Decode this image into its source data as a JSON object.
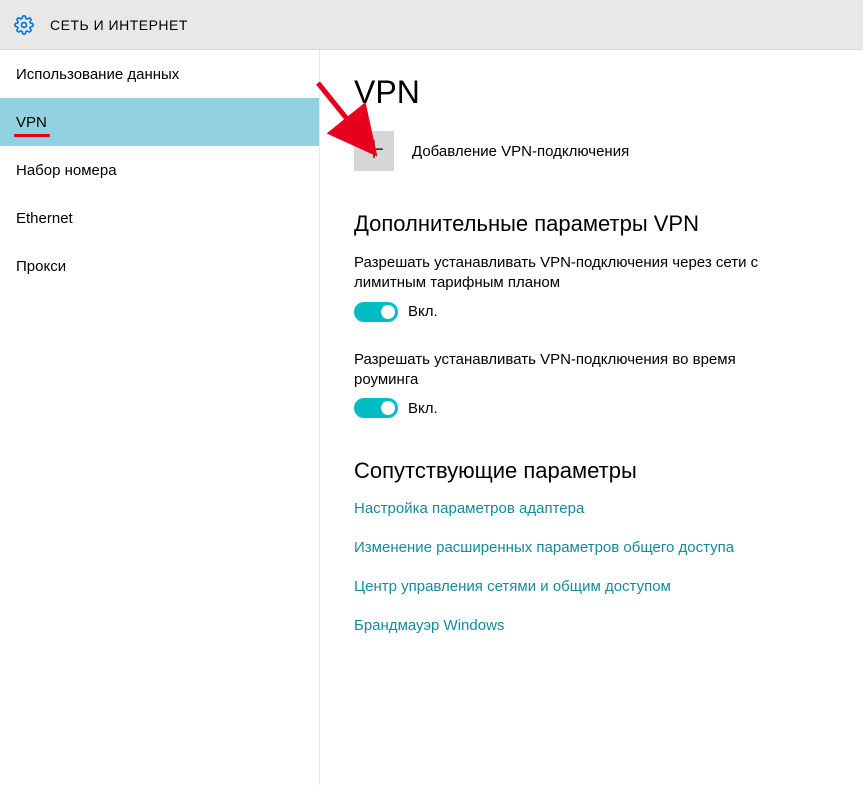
{
  "header": {
    "title": "СЕТЬ И ИНТЕРНЕТ"
  },
  "sidebar": {
    "items": [
      {
        "label": "Использование данных",
        "active": false
      },
      {
        "label": "VPN",
        "active": true
      },
      {
        "label": "Набор номера",
        "active": false
      },
      {
        "label": "Ethernet",
        "active": false
      },
      {
        "label": "Прокси",
        "active": false
      }
    ]
  },
  "main": {
    "page_title": "VPN",
    "add_label": "Добавление VPN-подключения",
    "advanced_title": "Дополнительные параметры VPN",
    "options": [
      {
        "text": "Разрешать устанавливать VPN-подключения через сети с лимитным тарифным планом",
        "state": "Вкл.",
        "on": true
      },
      {
        "text": "Разрешать устанавливать VPN-подключения во время роуминга",
        "state": "Вкл.",
        "on": true
      }
    ],
    "related_title": "Сопутствующие параметры",
    "related_links": [
      "Настройка параметров адаптера",
      "Изменение расширенных параметров общего доступа",
      "Центр управления сетями и общим доступом",
      "Брандмауэр Windows"
    ]
  }
}
